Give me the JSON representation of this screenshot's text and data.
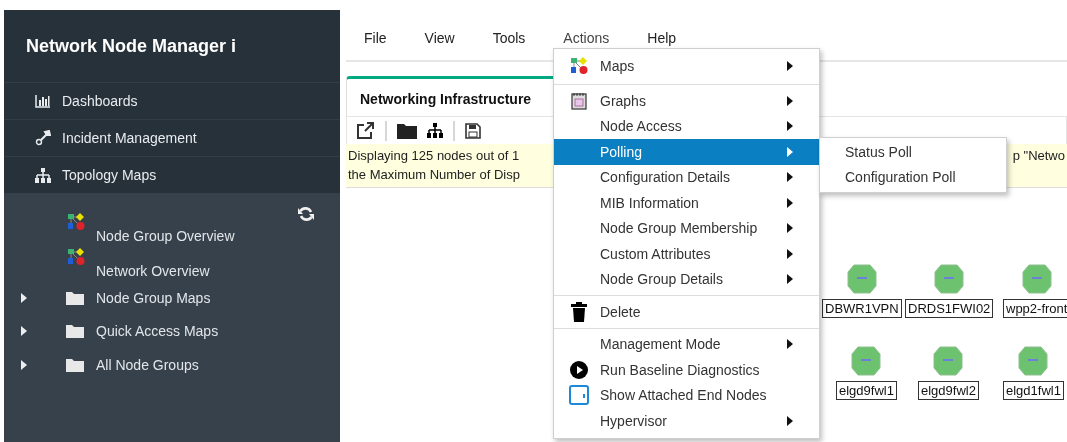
{
  "sidebar": {
    "title": "Network Node Manager i",
    "nav": [
      {
        "label": "Dashboards"
      },
      {
        "label": "Incident Management"
      },
      {
        "label": "Topology Maps"
      }
    ],
    "tree": [
      {
        "kind": "map",
        "label": "Node Group Overview"
      },
      {
        "kind": "map",
        "label": "Network Overview"
      },
      {
        "kind": "folder",
        "label": "Node Group Maps",
        "expanded": false
      },
      {
        "kind": "folder",
        "label": "Quick Access Maps",
        "expanded": false
      },
      {
        "kind": "folder",
        "label": "All Node Groups",
        "expanded": false
      }
    ]
  },
  "menubar": [
    {
      "label": "File",
      "selected": false
    },
    {
      "label": "View",
      "selected": false
    },
    {
      "label": "Tools",
      "selected": false
    },
    {
      "label": "Actions",
      "selected": true
    },
    {
      "label": "Help",
      "selected": false
    }
  ],
  "tabs": [
    {
      "label": "Networking Infrastructure",
      "selected": true
    }
  ],
  "notice": {
    "lines": [
      "Displaying 125 nodes out of 1",
      "the Maximum Number of Disp"
    ],
    "tail": "p \"Netwo"
  },
  "map_nodes": [
    {
      "label": "DBWR1VPN"
    },
    {
      "label": "DRDS1FWI02"
    },
    {
      "label": "wpp2-front"
    },
    {
      "label": "elgd9fwl1"
    },
    {
      "label": "elgd9fwl2"
    },
    {
      "label": "elgd1fwl1"
    }
  ],
  "menu": {
    "items": [
      {
        "label": "Maps",
        "submenu": true,
        "selected": false
      },
      {
        "kind": "separator"
      },
      {
        "label": "Graphs",
        "submenu": true,
        "selected": false
      },
      {
        "label": "Node Access",
        "submenu": true,
        "selected": false
      },
      {
        "label": "Polling",
        "submenu": true,
        "selected": true
      },
      {
        "label": "Configuration Details",
        "submenu": true,
        "selected": false
      },
      {
        "label": "MIB Information",
        "submenu": true,
        "selected": false
      },
      {
        "label": "Node Group Membership",
        "submenu": true,
        "selected": false
      },
      {
        "label": "Custom Attributes",
        "submenu": true,
        "selected": false
      },
      {
        "label": "Node Group Details",
        "submenu": true,
        "selected": false
      },
      {
        "kind": "separator"
      },
      {
        "label": "Delete",
        "submenu": false,
        "selected": false
      },
      {
        "kind": "separator"
      },
      {
        "label": "Management Mode",
        "submenu": true,
        "selected": false
      },
      {
        "label": "Run Baseline Diagnostics",
        "submenu": false,
        "selected": false
      },
      {
        "label": "Show Attached End Nodes",
        "submenu": false,
        "selected": false
      },
      {
        "label": "Hypervisor",
        "submenu": true,
        "selected": false
      }
    ]
  },
  "submenu": {
    "items": [
      {
        "label": "Status Poll",
        "selected": false
      },
      {
        "label": "Configuration Poll",
        "selected": false
      }
    ]
  }
}
